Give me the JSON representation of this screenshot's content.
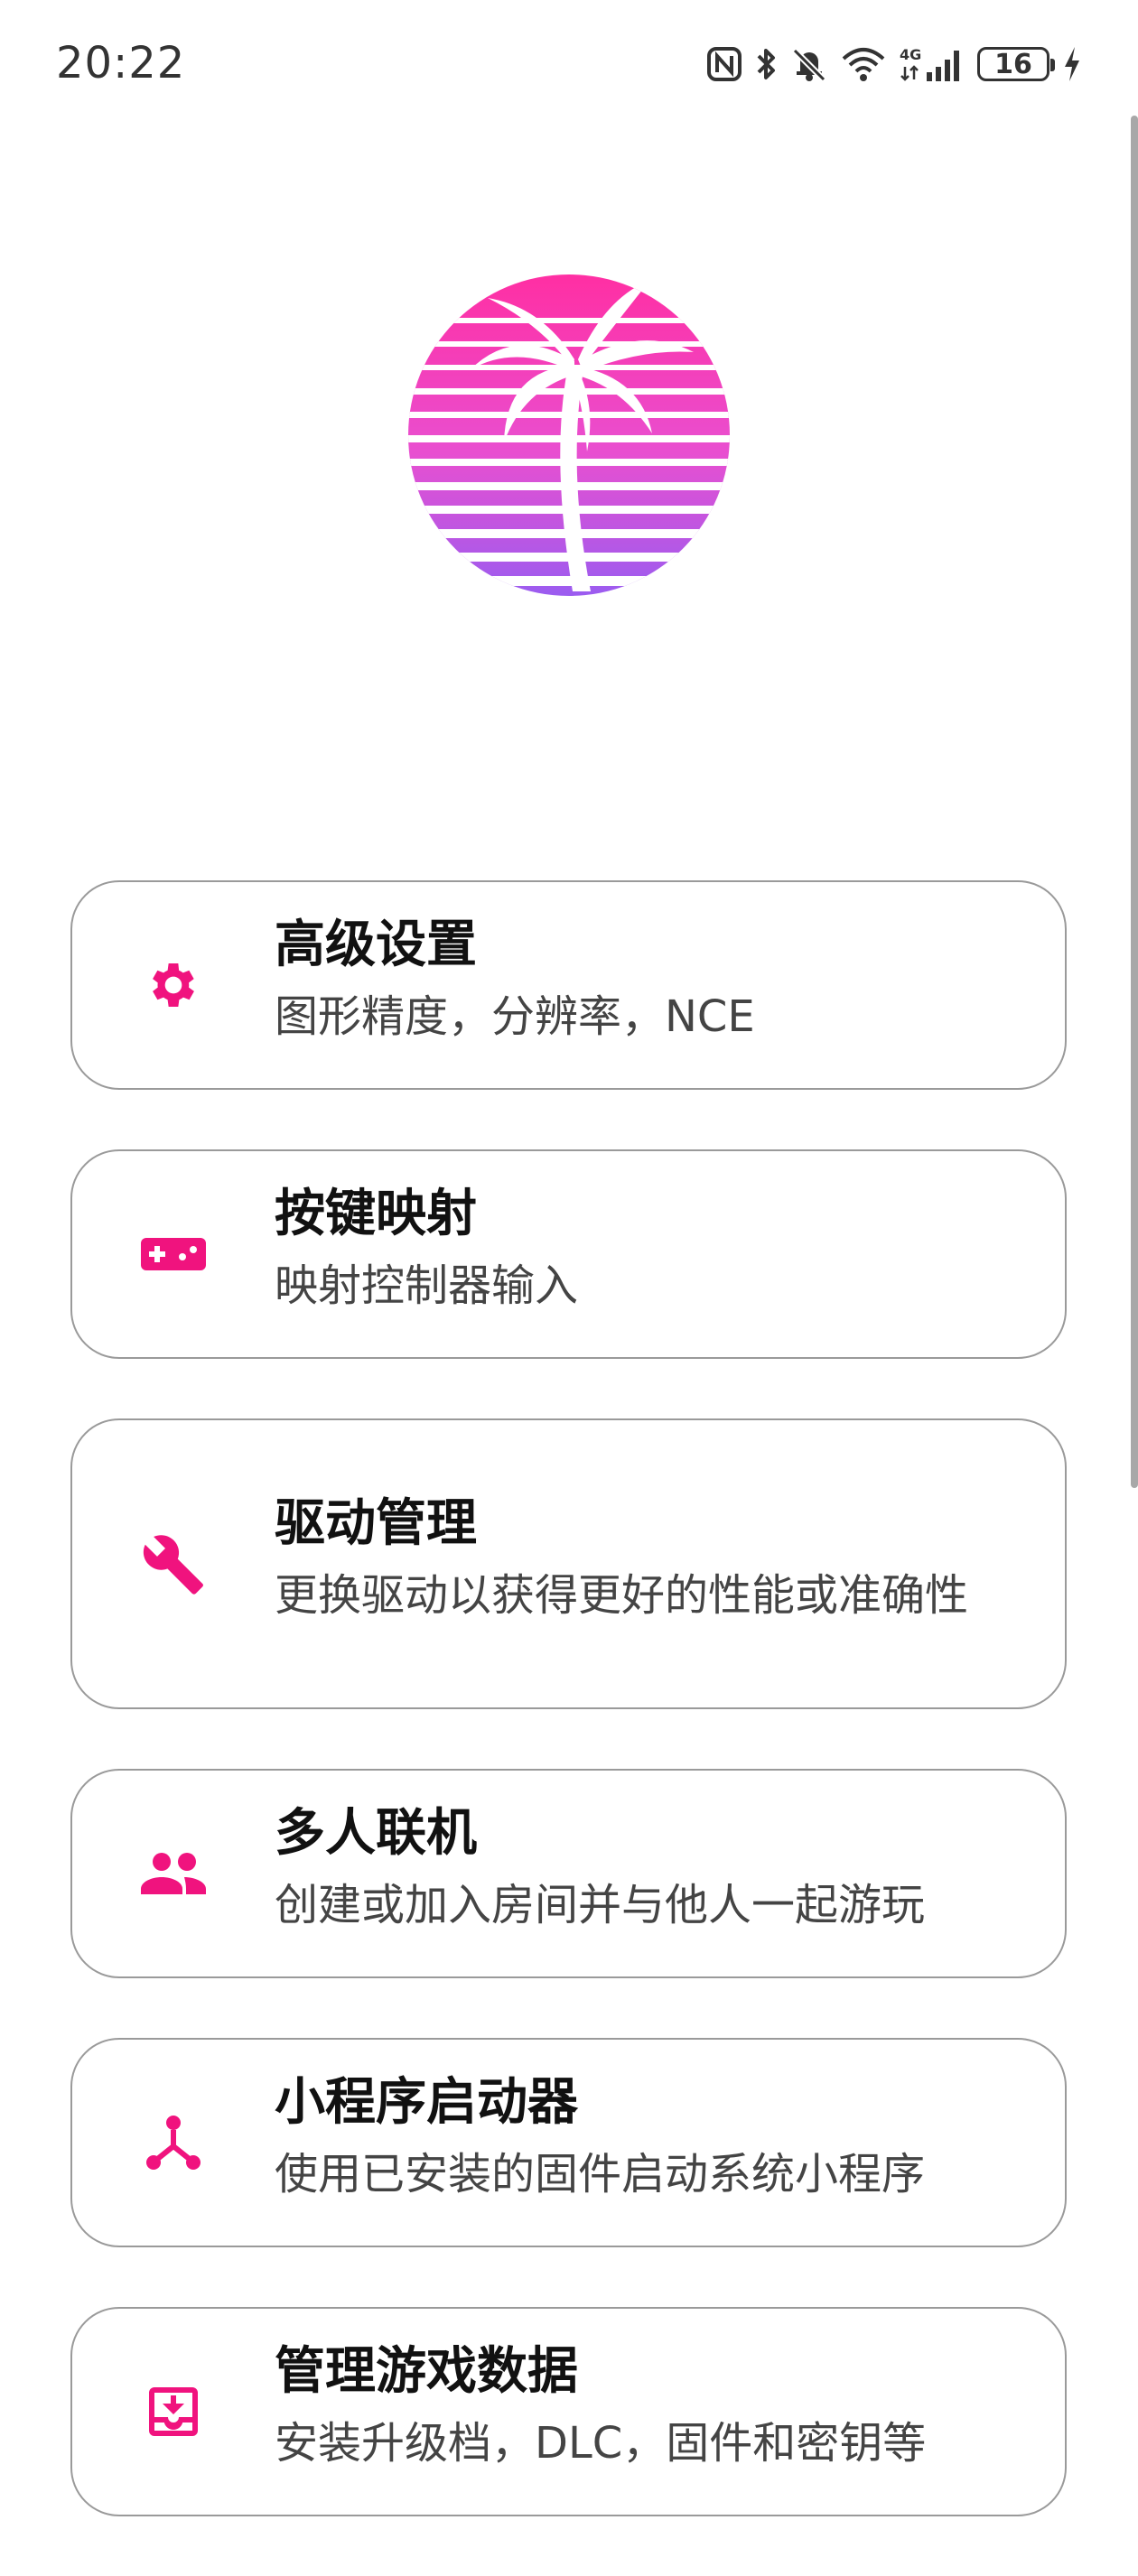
{
  "status_bar": {
    "time": "20:22",
    "icons": [
      "nfc-icon",
      "bluetooth-icon",
      "mute-icon",
      "wifi-icon",
      "signal-4g-icon"
    ],
    "network_label": "4G",
    "battery": "16"
  },
  "logo": {
    "icon": "palm-tree-sunset-logo",
    "colors": [
      "#ff3ea5",
      "#9b5cf0"
    ]
  },
  "accent_color": "#f0137e",
  "menu": {
    "items": [
      {
        "title": "高级设置",
        "description": "图形精度，分辨率，NCE",
        "icon": "gear-icon"
      },
      {
        "title": "按键映射",
        "description": "映射控制器输入",
        "icon": "gamepad-icon"
      },
      {
        "title": "驱动管理",
        "description": "更换驱动以获得更好的性能或准确性",
        "icon": "wrench-icon"
      },
      {
        "title": "多人联机",
        "description": "创建或加入房间并与他人一起游玩",
        "icon": "people-icon"
      },
      {
        "title": "小程序启动器",
        "description": "使用已安装的固件启动系统小程序",
        "icon": "applet-icon"
      },
      {
        "title": "管理游戏数据",
        "description": "安装升级档，DLC，固件和密钥等",
        "icon": "download-box-icon"
      }
    ]
  }
}
